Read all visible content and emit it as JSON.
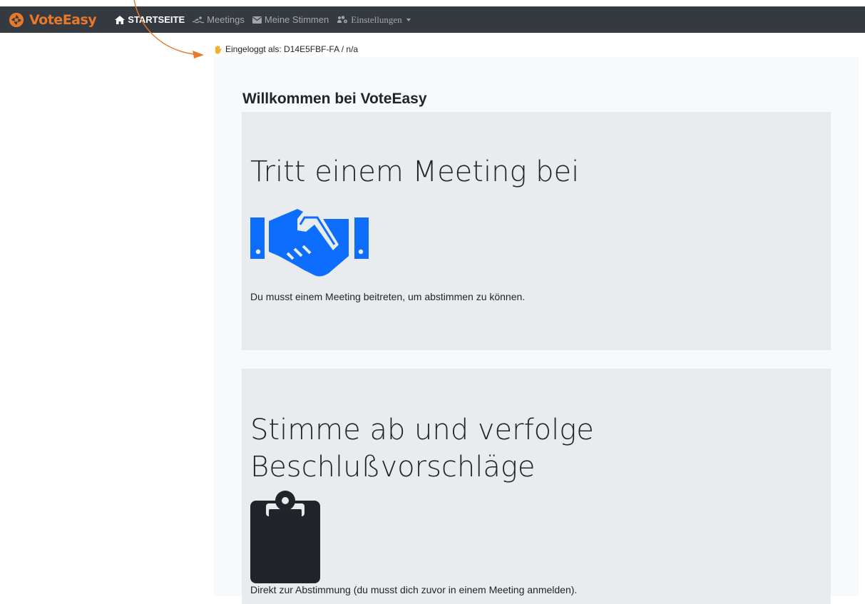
{
  "brand": {
    "name": "VoteEasy",
    "accent_color": "#e8782a"
  },
  "nav": {
    "home": {
      "label": "STARTSEITE",
      "icon": "home-icon"
    },
    "meetings": {
      "label": "Meetings",
      "icon": "swimmer-icon"
    },
    "votes": {
      "label": "Meine Stimmen",
      "icon": "envelope-icon"
    },
    "settings": {
      "label": "Einstellungen",
      "icon": "users-cog-icon"
    }
  },
  "status": {
    "logged_in_text": "Eingeloggt als: D14E5FBF-FA / n/a",
    "icon": "hand-icon"
  },
  "main": {
    "welcome_title": "Willkommen bei VoteEasy",
    "cards": [
      {
        "title": "Tritt einem Meeting bei",
        "icon": "handshake-icon",
        "text": "Du musst einem Meeting beitreten, um abstimmen zu können."
      },
      {
        "title": "Stimme ab und verfolge Beschlußvorschläge",
        "icon": "clipboard-icon",
        "text": "Direkt zur Abstimmung (du musst dich zuvor in einem Meeting anmelden)."
      }
    ]
  },
  "colors": {
    "navbar": "#343a40",
    "icon_blue": "#0d6efd",
    "icon_dark": "#212529",
    "card_bg": "#e9ecef"
  }
}
